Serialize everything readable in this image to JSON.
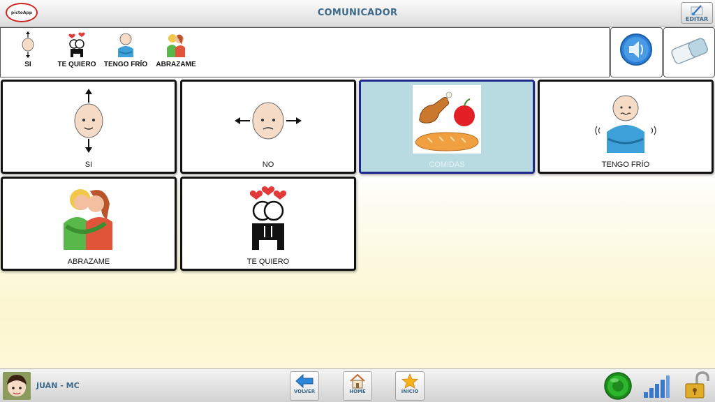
{
  "app": {
    "title": "COMUNICADOR",
    "logo_text": "pictoApp"
  },
  "toolbar": {
    "edit_label": "EDITAR"
  },
  "sentence": [
    {
      "label": "SI",
      "icon": "head-nod-icon"
    },
    {
      "label": "TE QUIERO",
      "icon": "love-couple-icon"
    },
    {
      "label": "TENGO FRÍO",
      "icon": "cold-person-icon"
    },
    {
      "label": "ABRAZAME",
      "icon": "hug-icon"
    }
  ],
  "grid": [
    {
      "label": "SI",
      "icon": "head-nod-icon"
    },
    {
      "label": "NO",
      "icon": "head-shake-icon"
    },
    {
      "label": "COMIDAS",
      "icon": "food-icon",
      "folder": true
    },
    {
      "label": "TENGO FRÍO",
      "icon": "cold-person-icon"
    },
    {
      "label": "ABRAZAME",
      "icon": "hug-icon"
    },
    {
      "label": "TE QUIERO",
      "icon": "love-couple-icon"
    }
  ],
  "user": {
    "name": "JUAN - MC"
  },
  "nav": {
    "back_label": "VOLVER",
    "home_label": "HOME",
    "start_label": "INICIO"
  },
  "colors": {
    "accent": "#3e6a8a",
    "folder_bg": "#b8dbe1",
    "folder_border": "#1e2a8c",
    "status_green": "#2db52d",
    "lock_gold": "#d9a21e"
  }
}
